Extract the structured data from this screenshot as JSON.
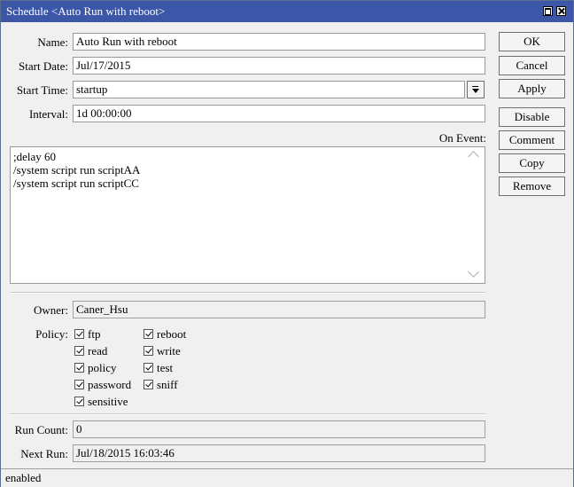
{
  "window": {
    "title": "Schedule <Auto Run with reboot>"
  },
  "form": {
    "name_label": "Name:",
    "name_value": "Auto Run with reboot",
    "start_date_label": "Start Date:",
    "start_date_value": "Jul/17/2015",
    "start_time_label": "Start Time:",
    "start_time_value": "startup",
    "interval_label": "Interval:",
    "interval_value": "1d 00:00:00",
    "on_event_label": "On Event:",
    "on_event_lines": [
      ";delay 60",
      "/system script run scriptAA",
      "/system script run scriptCC"
    ],
    "owner_label": "Owner:",
    "owner_value": "Caner_Hsu",
    "policy_label": "Policy:",
    "policies": [
      {
        "label": "ftp",
        "checked": true
      },
      {
        "label": "reboot",
        "checked": true
      },
      {
        "label": "read",
        "checked": true
      },
      {
        "label": "write",
        "checked": true
      },
      {
        "label": "policy",
        "checked": true
      },
      {
        "label": "test",
        "checked": true
      },
      {
        "label": "password",
        "checked": true
      },
      {
        "label": "sniff",
        "checked": true
      },
      {
        "label": "sensitive",
        "checked": true
      }
    ],
    "run_count_label": "Run Count:",
    "run_count_value": "0",
    "next_run_label": "Next Run:",
    "next_run_value": "Jul/18/2015 16:03:46"
  },
  "buttons": {
    "ok": "OK",
    "cancel": "Cancel",
    "apply": "Apply",
    "disable": "Disable",
    "comment": "Comment",
    "copy": "Copy",
    "remove": "Remove"
  },
  "status": {
    "text": "enabled"
  },
  "icons": {
    "maximize": "maximize-icon",
    "close": "close-icon",
    "dropdown": "dropdown-arrow-icon"
  }
}
